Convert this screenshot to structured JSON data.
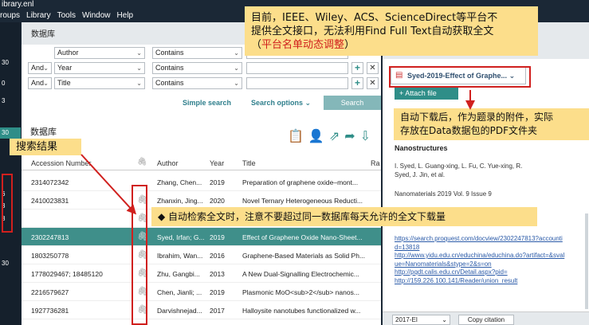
{
  "window": {
    "title": "ibrary.enl"
  },
  "menu": [
    "roups",
    "Library",
    "Tools",
    "Window",
    "Help"
  ],
  "left_strip": {
    "values": [
      "30",
      "0",
      "3",
      "30",
      "6",
      "3",
      "8",
      "30"
    ]
  },
  "center": {
    "library_title": "数据库",
    "search_rows": [
      {
        "bool": "",
        "field": "Author",
        "op": "Contains"
      },
      {
        "bool": "And",
        "field": "Year",
        "op": "Contains"
      },
      {
        "bool": "And",
        "field": "Title",
        "op": "Contains"
      }
    ],
    "simple_search": "Simple search",
    "search_options": "Search options",
    "search_button": "Search",
    "library_label": "数据库",
    "columns": [
      "Accession Number",
      "Author",
      "Year",
      "Title",
      "Ra"
    ],
    "rows": [
      {
        "acc": "2314072342",
        "author": "Zhang, Chen...",
        "year": "2019",
        "title": "Preparation of graphene oxide–mont...",
        "clip": false,
        "selected": false
      },
      {
        "acc": "2410023831",
        "author": "Zhanxin, Jing...",
        "year": "2020",
        "title": "Novel Ternary Heterogeneous Reducti...",
        "clip": true,
        "selected": false
      },
      {
        "acc": "",
        "author": "",
        "year": "",
        "title": "",
        "clip": true,
        "selected": false
      },
      {
        "acc": "2302247813",
        "author": "Syed, Irfan; G...",
        "year": "2019",
        "title": "Effect of Graphene Oxide Nano-Sheet...",
        "clip": true,
        "selected": true
      },
      {
        "acc": "1803250778",
        "author": "Ibrahim, Wan...",
        "year": "2016",
        "title": "Graphene-Based Materials as Solid Ph...",
        "clip": true,
        "selected": false
      },
      {
        "acc": "1778029467; 18485120",
        "author": "Zhu, Gangbi...",
        "year": "2013",
        "title": "A New Dual-Signalling Electrochemic...",
        "clip": true,
        "selected": false
      },
      {
        "acc": "2216579627",
        "author": "Chen, Jianli; ...",
        "year": "2019",
        "title": "Plasmonic MoO<sub>2</sub> nanos...",
        "clip": true,
        "selected": false
      },
      {
        "acc": "1927736281",
        "author": "Darvishnejad...",
        "year": "2017",
        "title": "Halloysite nanotubes functionalized w...",
        "clip": true,
        "selected": false
      }
    ]
  },
  "right": {
    "attachment_name": "Syed-2019-Effect of Graphe...",
    "attach_file": "Attach file",
    "ref_title": "Nanostructures",
    "ref_authors": "I. Syed, L. Guang-xing, L. Fu, C. Yue-xing, R. Syed, J. Jin, et al.",
    "ref_journal": "Nanomaterials 2019 Vol. 9 Issue 9",
    "ref_urls": [
      "https://search.proquest.com/docview/2302247813?accountid=13818",
      "http://www.yidu.edu.cn/educhina/educhina.do?artifact=&svalue=Nanomaterials&stype=2&s=on",
      "http://pqdt.calis.edu.cn/Detail.aspx?pid=",
      "http://159.226.100.141/Reader/union_result"
    ],
    "style_select": "2017-EI",
    "copy_citation": "Copy citation"
  },
  "annotations": {
    "top_line1": "目前，IEEE、Wiley、ACS、ScienceDirect等平台不",
    "top_line2": "提供全文接口，无法利用Find Full Text自动获取全文",
    "top_line3_open": "（",
    "top_line3_red": "平台名单动态调整",
    "top_line3_close": "）",
    "right_line1": "自动下载后，作为题录的附件，实际",
    "right_line2": "存放在Data数据包的PDF文件夹",
    "middle": "◆  自动检索全文时，注意不要超过同一数据库每天允许的全文下载量",
    "search_results": "搜索结果"
  },
  "colors": {
    "accent": "#2f8e88",
    "callout": "#fcde8b",
    "annotation_red": "#d0201e"
  }
}
